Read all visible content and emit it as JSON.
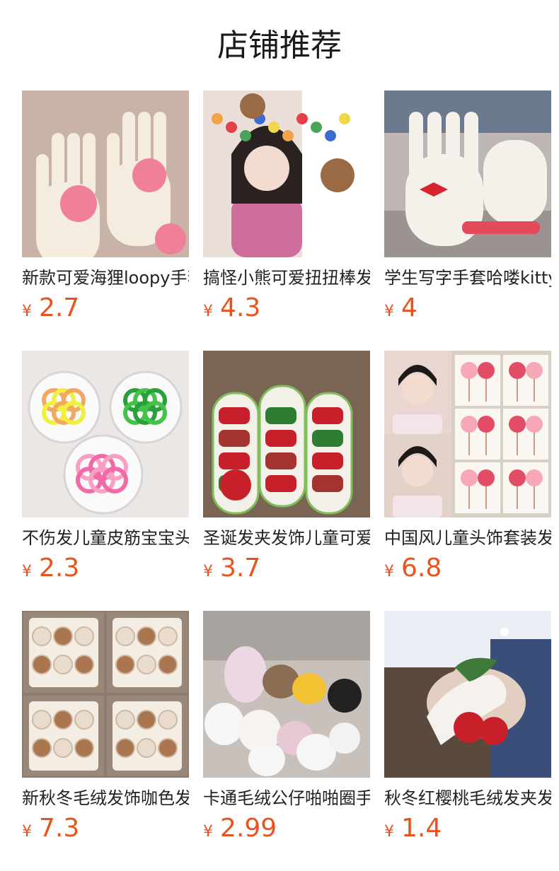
{
  "page": {
    "title": "店铺推荐"
  },
  "products": [
    {
      "name": "新款可爱海狸loopy手套",
      "currency": "¥",
      "price": "2.7",
      "image": "beaver-glove-photo",
      "colors": {
        "bg": "#c9b3a6",
        "main": "#f4ecdf",
        "accent": "#f07f9a"
      }
    },
    {
      "name": "搞怪小熊可爱扭扭棒发箍",
      "currency": "¥",
      "price": "4.3",
      "image": "bear-headband-photo",
      "colors": {
        "bg": "#e9dfd8",
        "main": "#cf6e9a",
        "accent": "#f3a24a"
      }
    },
    {
      "name": "学生写字手套哈喽kitty",
      "currency": "¥",
      "price": "4",
      "image": "kitty-glove-photo",
      "colors": {
        "bg": "#bdb6b4",
        "main": "#f4f0ea",
        "accent": "#d8232f"
      }
    },
    {
      "name": "不伤发儿童皮筋宝宝头绳",
      "currency": "¥",
      "price": "2.3",
      "image": "hair-ties-photo",
      "colors": {
        "bg": "#ece7e4",
        "main": "#eff040",
        "accent": "#f06aa8"
      }
    },
    {
      "name": "圣诞发夹发饰儿童可爱",
      "currency": "¥",
      "price": "3.7",
      "image": "christmas-clips-photo",
      "colors": {
        "bg": "#7a6555",
        "main": "#f2f0e8",
        "accent": "#c8202a"
      }
    },
    {
      "name": "中国风儿童头饰套装发夹",
      "currency": "¥",
      "price": "6.8",
      "image": "chinese-headwear-photo",
      "colors": {
        "bg": "#d8cfc6",
        "main": "#f2dde2",
        "accent": "#e24c64"
      }
    },
    {
      "name": "新秋冬毛绒发饰咖色发夹",
      "currency": "¥",
      "price": "7.3",
      "image": "plush-hair-clips-photo",
      "colors": {
        "bg": "#8c7b6f",
        "main": "#e9dccc",
        "accent": "#a9764f"
      }
    },
    {
      "name": "卡通毛绒公仔啪啪圈手环",
      "currency": "¥",
      "price": "2.99",
      "image": "plush-slap-bands-photo",
      "colors": {
        "bg": "#c8c0bb",
        "main": "#f6f3f0",
        "accent": "#e8c8d4"
      }
    },
    {
      "name": "秋冬红樱桃毛绒发夹发饰",
      "currency": "¥",
      "price": "1.4",
      "image": "cherry-plush-clip-photo",
      "colors": {
        "bg": "#5a4a3e",
        "main": "#f5f2ee",
        "accent": "#c8202a"
      }
    }
  ]
}
